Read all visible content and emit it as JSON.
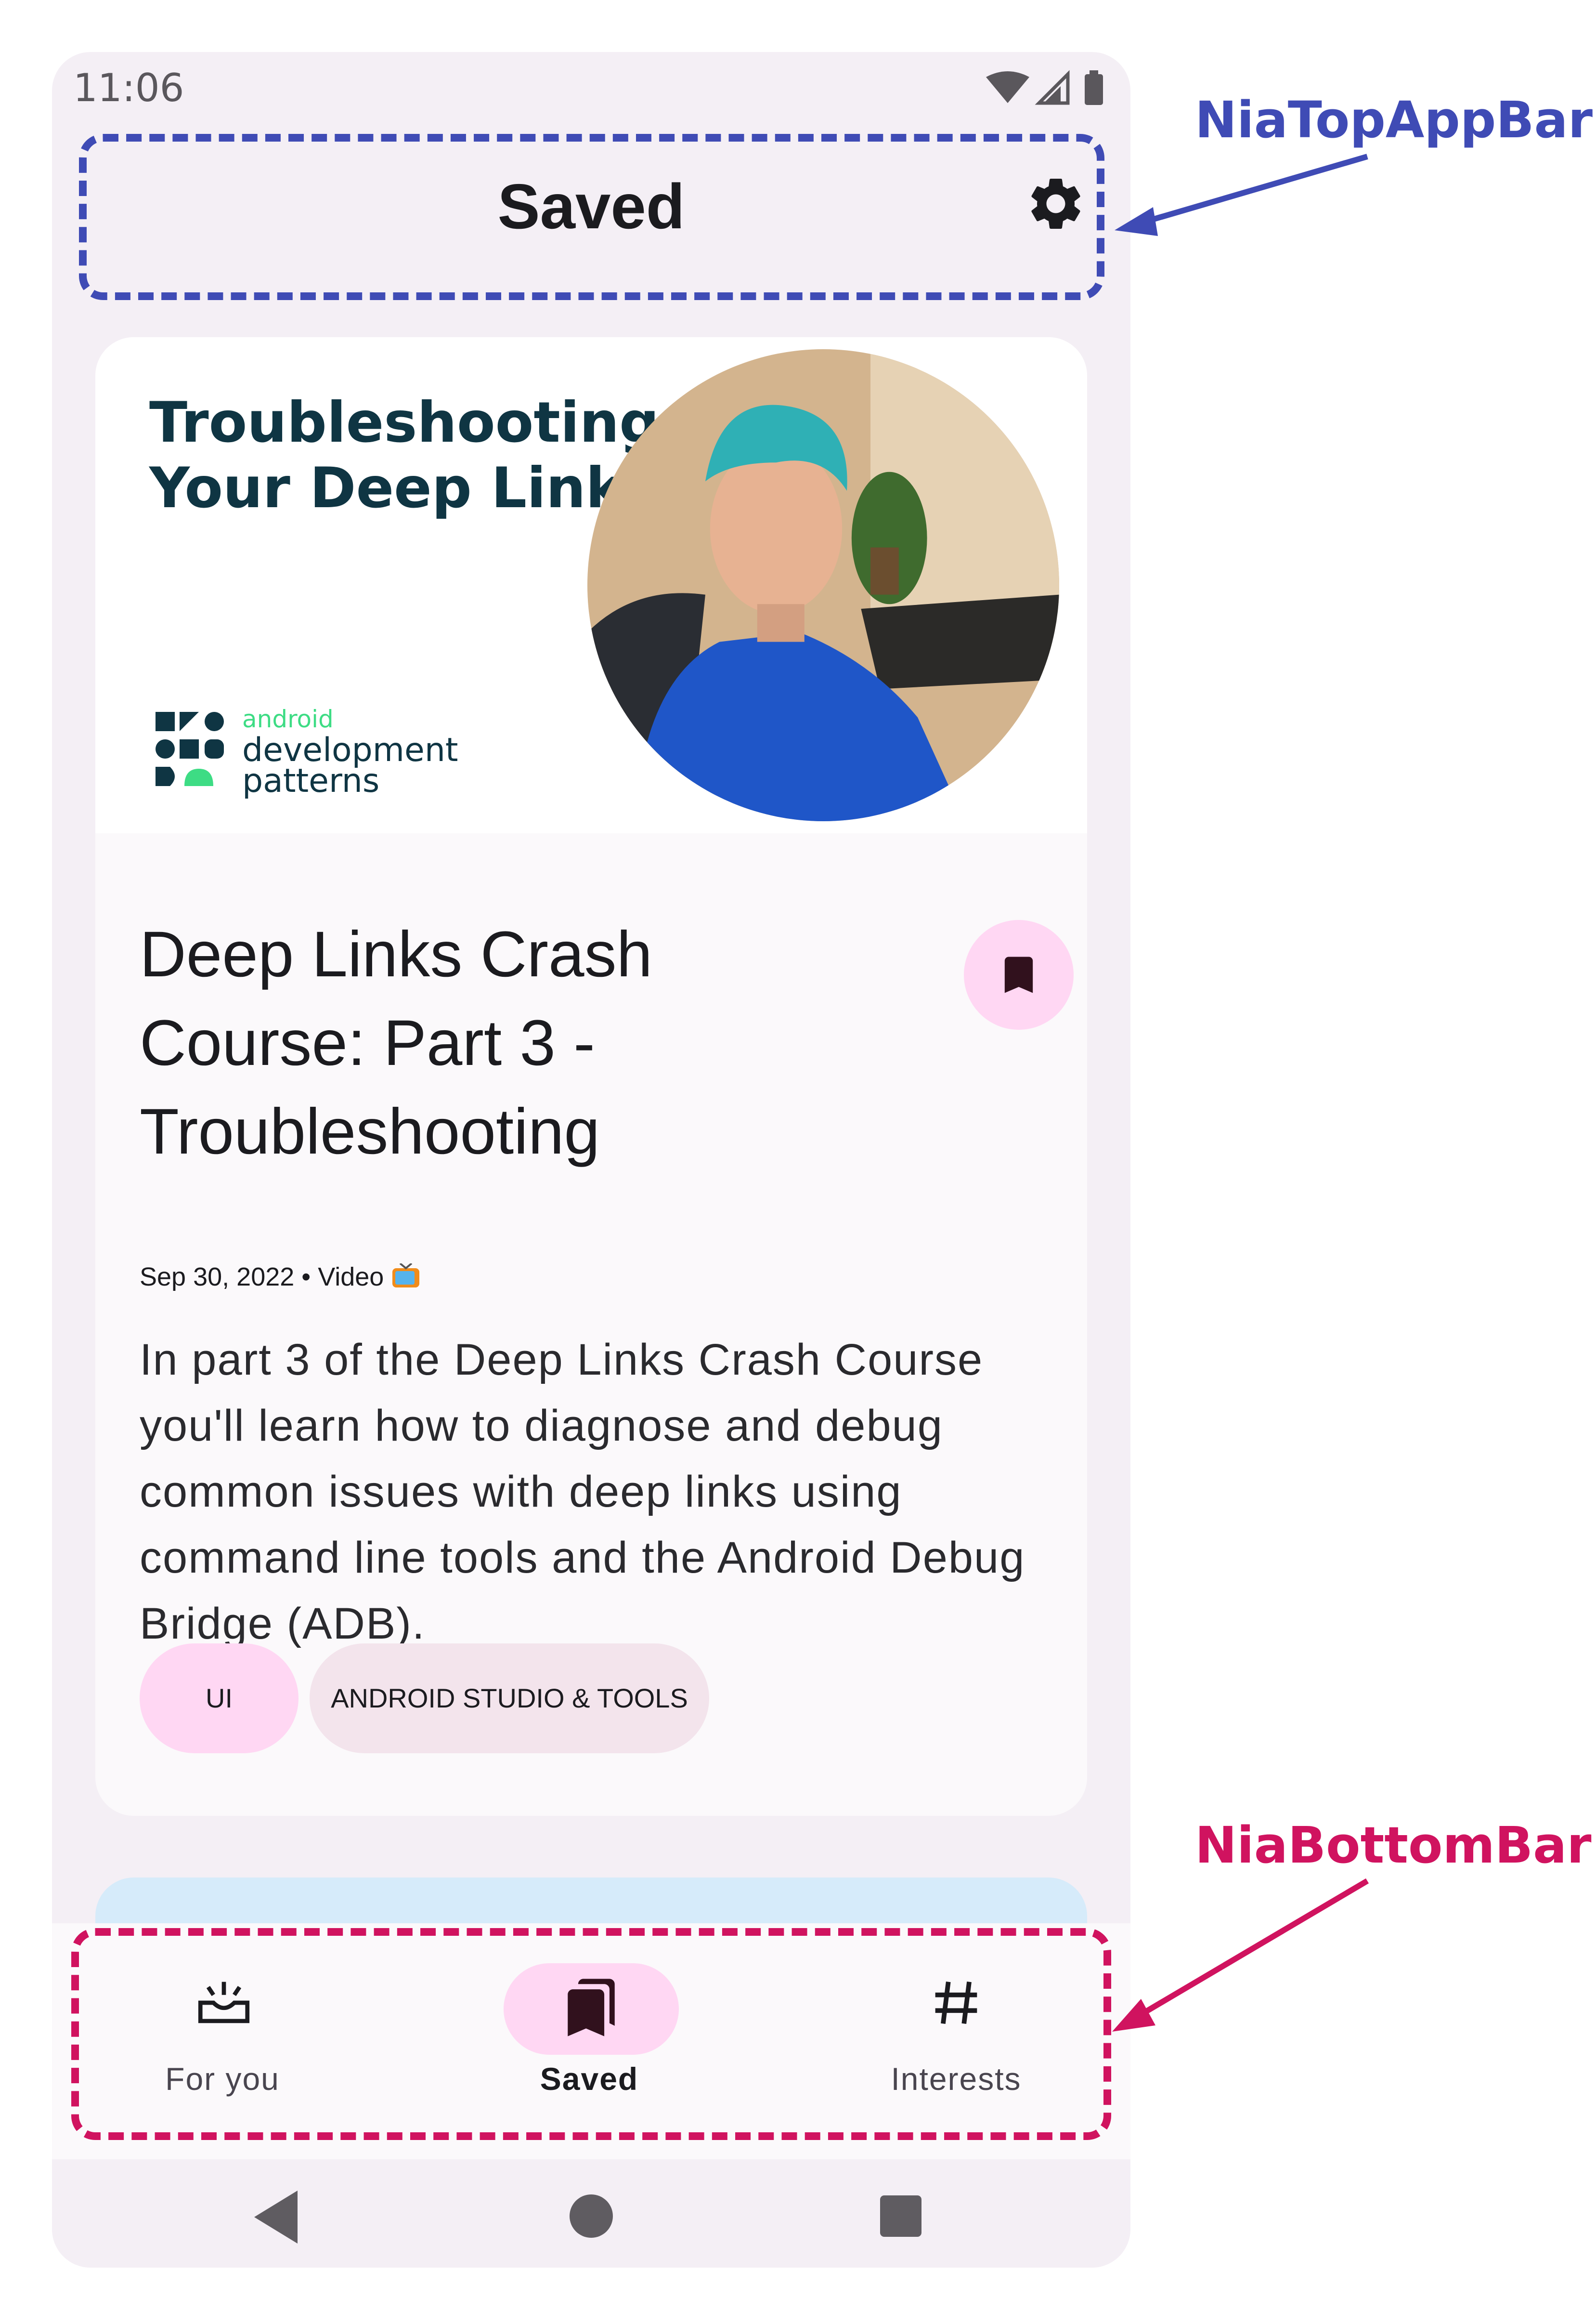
{
  "status_bar": {
    "time": "11:06"
  },
  "top_app_bar": {
    "title": "Saved",
    "action_icon": "gear-icon"
  },
  "card": {
    "header_image": {
      "title_line1": "Troubleshooting",
      "title_line2": "Your Deep Links",
      "logo_line1": "android",
      "logo_line2": "development",
      "logo_line3": "patterns"
    },
    "title": "Deep Links Crash Course: Part 3 - Troubleshooting",
    "meta": "Sep 30, 2022 • Video",
    "meta_icon": "tv-icon",
    "bookmark_icon": "bookmark-icon",
    "description": "In part 3 of the Deep Links Crash Course you'll learn how to diagnose and debug common issues with deep links using command line tools and the Android Debug Bridge (ADB).",
    "topics": [
      "UI",
      "ANDROID STUDIO & TOOLS"
    ]
  },
  "bottom_bar": {
    "items": [
      {
        "label": "For you",
        "icon": "upcoming-icon",
        "selected": false
      },
      {
        "label": "Saved",
        "icon": "bookmarks-icon",
        "selected": true
      },
      {
        "label": "Interests",
        "icon": "hash-icon",
        "selected": false
      }
    ]
  },
  "annotations": {
    "top": "NiaTopAppBar",
    "bottom": "NiaBottomBar"
  },
  "colors": {
    "top_annotation": "#3f4bb5",
    "bottom_annotation": "#d0135f",
    "surface": "#f4eff5",
    "selected_container": "#ffd7f3"
  }
}
